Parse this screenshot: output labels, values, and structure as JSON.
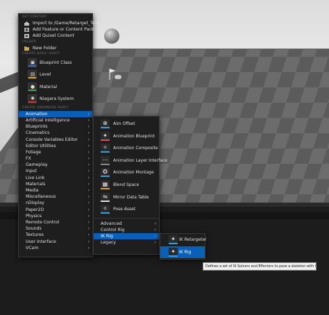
{
  "left_menu": {
    "get_content_header": "GET CONTENT",
    "get_content": [
      {
        "label": "Import to /Game/Retarget_Test...",
        "icon": "import-icon"
      },
      {
        "label": "Add Feature or Content Pack...",
        "icon": "add-feature-icon"
      },
      {
        "label": "Add Quixel Content",
        "icon": "quixel-icon"
      }
    ],
    "folder_header": "FOLDER",
    "new_folder": "New Folder",
    "basic_header": "CREATE BASIC ASSET",
    "basic_assets": [
      {
        "label": "Blueprint Class",
        "icon": "blueprint-icon",
        "color": "#2d6bd8"
      },
      {
        "label": "Level",
        "icon": "level-icon",
        "color": "#e0a020"
      },
      {
        "label": "Material",
        "icon": "material-icon",
        "color": "#3aa644"
      },
      {
        "label": "Niagara System",
        "icon": "niagara-icon",
        "color": "#d83030"
      }
    ],
    "advanced_header": "CREATE ADVANCED ASSET",
    "advanced_items": [
      "Animation",
      "Artificial Intelligence",
      "Blueprints",
      "Cinematics",
      "Console Variables Editor",
      "Editor Utilities",
      "Foliage",
      "FX",
      "Gameplay",
      "Input",
      "Live Link",
      "Materials",
      "Media",
      "Miscellaneous",
      "nDisplay",
      "Paper2D",
      "Physics",
      "Remote Control",
      "Sounds",
      "Textures",
      "User Interface",
      "VCam"
    ],
    "selected_index": 0
  },
  "animation_menu": {
    "items": [
      {
        "label": "Aim Offset",
        "icon": "aim-offset-icon",
        "color": "#3a9fd8"
      },
      {
        "label": "Animation Blueprint",
        "icon": "animation-blueprint-icon",
        "color": "#e05050"
      },
      {
        "label": "Animation Composite",
        "icon": "animation-composite-icon",
        "color": "#3a9fd8"
      },
      {
        "label": "Animation Layer Interface",
        "icon": "animation-layer-interface-icon",
        "color": "#888888"
      },
      {
        "label": "Animation Montage",
        "icon": "animation-montage-icon",
        "color": "#3a9fd8"
      },
      {
        "label": "Blend Space",
        "icon": "blend-space-icon",
        "color": "#e0a020"
      },
      {
        "label": "Mirror Data Table",
        "icon": "mirror-data-table-icon",
        "color": "#e0e0e0"
      },
      {
        "label": "Pose Asset",
        "icon": "pose-asset-icon",
        "color": "#3a9fd8"
      }
    ],
    "submenus": [
      "Advanced",
      "Control Rig",
      "IK Rig",
      "Legacy"
    ],
    "selected_submenu": 2
  },
  "ikrig_menu": {
    "items": [
      {
        "label": "IK Retargeter",
        "icon": "ik-retargeter-icon",
        "color": "#3a9fd8"
      },
      {
        "label": "IK Rig",
        "icon": "ik-rig-icon",
        "color": "#3a9fd8"
      }
    ],
    "selected_index": 1
  },
  "tooltip": "Defines a set of IK Solvers and Effectors to pose a skeleton with Goals."
}
